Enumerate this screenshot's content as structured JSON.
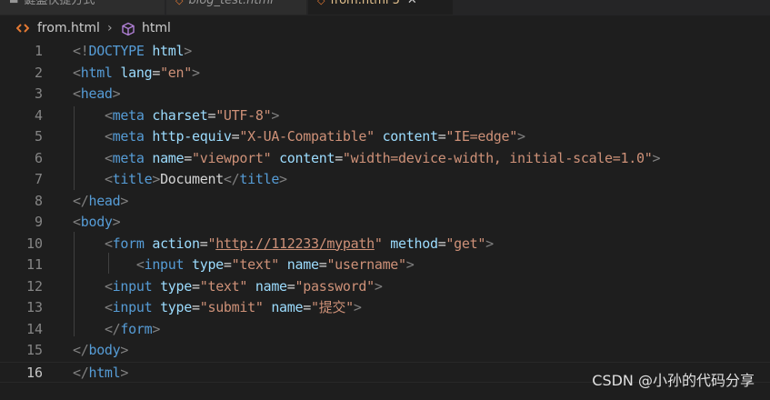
{
  "tabs": [
    {
      "label": "鍵盤快捷方式",
      "icon": "keyboard-icon",
      "active": false
    },
    {
      "label": "blog_test.html",
      "icon": "html-file-icon",
      "active": false
    },
    {
      "label": "from.html",
      "modified_count": "5",
      "icon": "html-file-icon",
      "active": true
    }
  ],
  "breadcrumb": {
    "file": "from.html",
    "symbol": "html",
    "file_icon": "html-file-icon",
    "symbol_icon": "symbol-cube-icon"
  },
  "editor": {
    "active_line": 16,
    "lines": [
      {
        "num": "1",
        "tokens": [
          [
            "br",
            "<!"
          ],
          [
            "tag",
            "DOCTYPE"
          ],
          [
            "txt",
            " "
          ],
          [
            "attr",
            "html"
          ],
          [
            "br",
            ">"
          ]
        ]
      },
      {
        "num": "2",
        "tokens": [
          [
            "br",
            "<"
          ],
          [
            "tag",
            "html"
          ],
          [
            "txt",
            " "
          ],
          [
            "attr",
            "lang"
          ],
          [
            "txt",
            "="
          ],
          [
            "str",
            "\"en\""
          ],
          [
            "br",
            ">"
          ]
        ]
      },
      {
        "num": "3",
        "tokens": [
          [
            "br",
            "<"
          ],
          [
            "tag",
            "head"
          ],
          [
            "br",
            ">"
          ]
        ]
      },
      {
        "num": "4",
        "tokens": [
          [
            "txt",
            "    "
          ],
          [
            "br",
            "<"
          ],
          [
            "tag",
            "meta"
          ],
          [
            "txt",
            " "
          ],
          [
            "attr",
            "charset"
          ],
          [
            "txt",
            "="
          ],
          [
            "str",
            "\"UTF-8\""
          ],
          [
            "br",
            ">"
          ]
        ]
      },
      {
        "num": "5",
        "tokens": [
          [
            "txt",
            "    "
          ],
          [
            "br",
            "<"
          ],
          [
            "tag",
            "meta"
          ],
          [
            "txt",
            " "
          ],
          [
            "attr",
            "http-equiv"
          ],
          [
            "txt",
            "="
          ],
          [
            "str",
            "\"X-UA-Compatible\""
          ],
          [
            "txt",
            " "
          ],
          [
            "attr",
            "content"
          ],
          [
            "txt",
            "="
          ],
          [
            "str",
            "\"IE=edge\""
          ],
          [
            "br",
            ">"
          ]
        ]
      },
      {
        "num": "6",
        "tokens": [
          [
            "txt",
            "    "
          ],
          [
            "br",
            "<"
          ],
          [
            "tag",
            "meta"
          ],
          [
            "txt",
            " "
          ],
          [
            "attr",
            "name"
          ],
          [
            "txt",
            "="
          ],
          [
            "str",
            "\"viewport\""
          ],
          [
            "txt",
            " "
          ],
          [
            "attr",
            "content"
          ],
          [
            "txt",
            "="
          ],
          [
            "str",
            "\"width=device-width, initial-scale=1.0\""
          ],
          [
            "br",
            ">"
          ]
        ]
      },
      {
        "num": "7",
        "tokens": [
          [
            "txt",
            "    "
          ],
          [
            "br",
            "<"
          ],
          [
            "tag",
            "title"
          ],
          [
            "br",
            ">"
          ],
          [
            "txt",
            "Document"
          ],
          [
            "br",
            "</"
          ],
          [
            "tag",
            "title"
          ],
          [
            "br",
            ">"
          ]
        ]
      },
      {
        "num": "8",
        "tokens": [
          [
            "br",
            "</"
          ],
          [
            "tag",
            "head"
          ],
          [
            "br",
            ">"
          ]
        ]
      },
      {
        "num": "9",
        "tokens": [
          [
            "br",
            "<"
          ],
          [
            "tag",
            "body"
          ],
          [
            "br",
            ">"
          ]
        ]
      },
      {
        "num": "10",
        "tokens": [
          [
            "txt",
            "    "
          ],
          [
            "br",
            "<"
          ],
          [
            "tag",
            "form"
          ],
          [
            "txt",
            " "
          ],
          [
            "attr",
            "action"
          ],
          [
            "txt",
            "="
          ],
          [
            "str",
            "\""
          ],
          [
            "link",
            "http://112233/mypath"
          ],
          [
            "str",
            "\""
          ],
          [
            "txt",
            " "
          ],
          [
            "attr",
            "method"
          ],
          [
            "txt",
            "="
          ],
          [
            "str",
            "\"get\""
          ],
          [
            "br",
            ">"
          ]
        ]
      },
      {
        "num": "11",
        "tokens": [
          [
            "txt",
            "        "
          ],
          [
            "br",
            "<"
          ],
          [
            "tag",
            "input"
          ],
          [
            "txt",
            " "
          ],
          [
            "attr",
            "type"
          ],
          [
            "txt",
            "="
          ],
          [
            "str",
            "\"text\""
          ],
          [
            "txt",
            " "
          ],
          [
            "attr",
            "name"
          ],
          [
            "txt",
            "="
          ],
          [
            "str",
            "\"username\""
          ],
          [
            "br",
            ">"
          ]
        ]
      },
      {
        "num": "12",
        "tokens": [
          [
            "txt",
            "    "
          ],
          [
            "br",
            "<"
          ],
          [
            "tag",
            "input"
          ],
          [
            "txt",
            " "
          ],
          [
            "attr",
            "type"
          ],
          [
            "txt",
            "="
          ],
          [
            "str",
            "\"text\""
          ],
          [
            "txt",
            " "
          ],
          [
            "attr",
            "name"
          ],
          [
            "txt",
            "="
          ],
          [
            "str",
            "\"password\""
          ],
          [
            "br",
            ">"
          ]
        ]
      },
      {
        "num": "13",
        "tokens": [
          [
            "txt",
            "    "
          ],
          [
            "br",
            "<"
          ],
          [
            "tag",
            "input"
          ],
          [
            "txt",
            " "
          ],
          [
            "attr",
            "type"
          ],
          [
            "txt",
            "="
          ],
          [
            "str",
            "\"submit\""
          ],
          [
            "txt",
            " "
          ],
          [
            "attr",
            "name"
          ],
          [
            "txt",
            "="
          ],
          [
            "str",
            "\"提交\""
          ],
          [
            "br",
            ">"
          ]
        ]
      },
      {
        "num": "14",
        "tokens": [
          [
            "txt",
            "    "
          ],
          [
            "br",
            "</"
          ],
          [
            "tag",
            "form"
          ],
          [
            "br",
            ">"
          ]
        ]
      },
      {
        "num": "15",
        "tokens": [
          [
            "br",
            "</"
          ],
          [
            "tag",
            "body"
          ],
          [
            "br",
            ">"
          ]
        ]
      },
      {
        "num": "16",
        "tokens": [
          [
            "br",
            "</"
          ],
          [
            "tag",
            "html"
          ],
          [
            "br",
            ">"
          ]
        ]
      }
    ]
  },
  "colors": {
    "background": "#1e1e1e",
    "tag": "#569cd6",
    "attribute": "#9cdcfe",
    "string": "#ce9178",
    "bracket": "#808080",
    "text": "#d4d4d4",
    "modified_tab": "#e2c08d"
  },
  "watermark": "CSDN @小孙的代码分享"
}
